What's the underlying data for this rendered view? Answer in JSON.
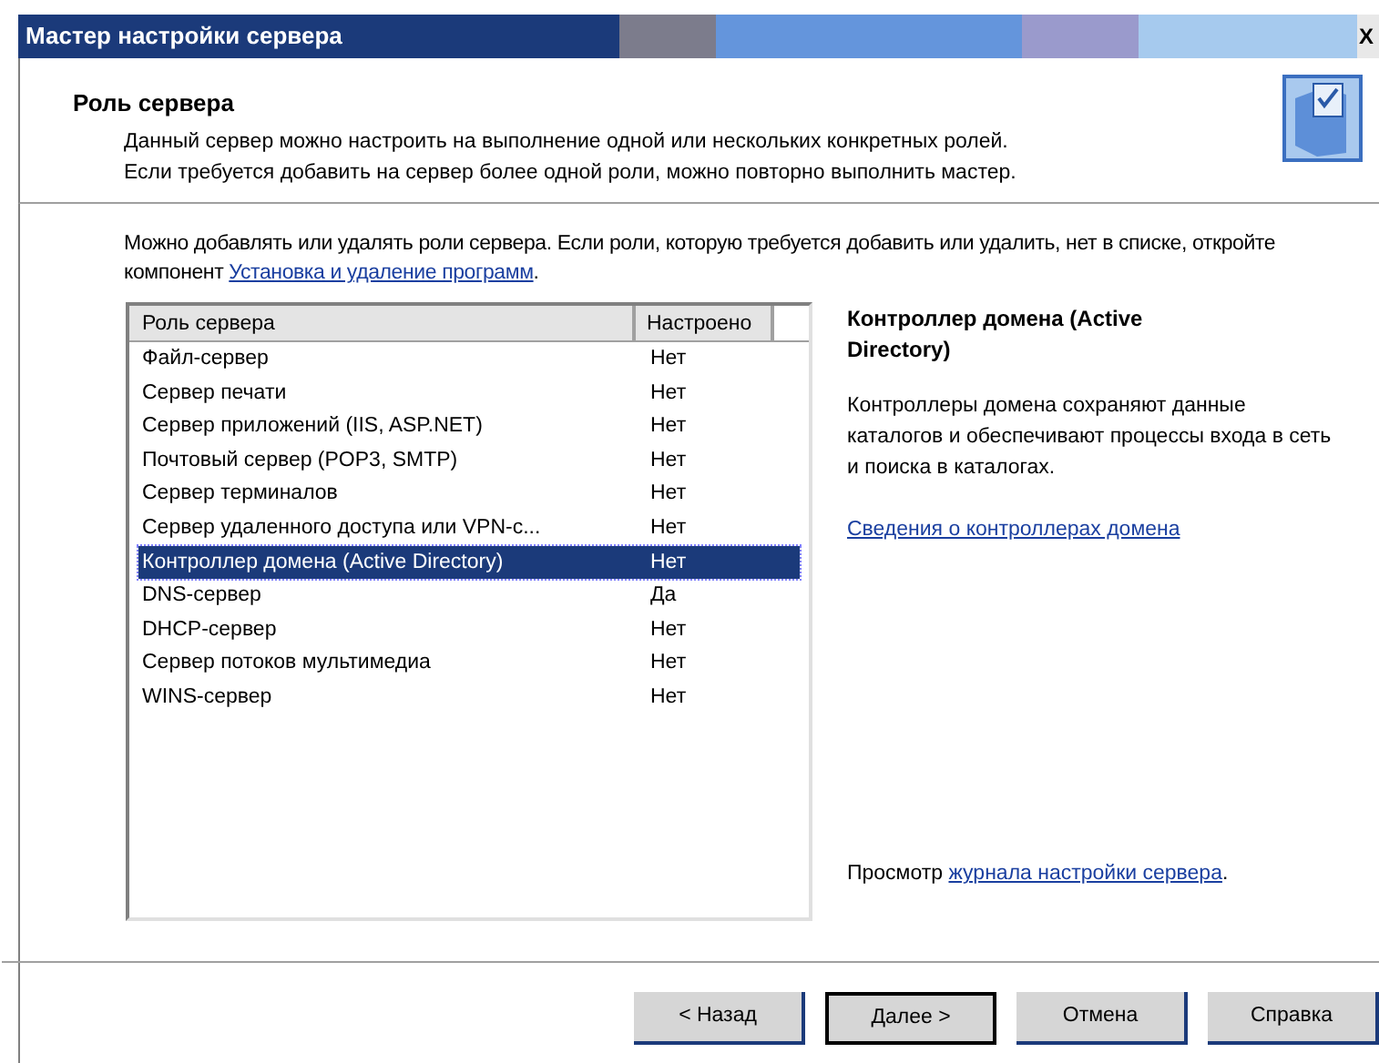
{
  "window": {
    "title": "Мастер настройки сервера",
    "close": "X"
  },
  "header": {
    "title": "Роль сервера",
    "lines": [
      "Данный сервер можно настроить на выполнение одной или нескольких конкретных ролей.",
      "Если требуется добавить на сервер более одной роли, можно повторно выполнить мастер."
    ]
  },
  "intro": {
    "text": "Можно добавлять или удалять роли сервера. Если роли, которую требуется добавить или удалить, нет в списке, откройте компонент",
    "link": "Установка и удаление программ",
    "end": "."
  },
  "table": {
    "columns": [
      "Роль сервера",
      "Настроено"
    ],
    "rows": [
      {
        "role": "Файл-сервер",
        "configured": "Нет",
        "selected": false
      },
      {
        "role": "Сервер печати",
        "configured": "Нет",
        "selected": false
      },
      {
        "role": "Сервер приложений (IIS, ASP.NET)",
        "configured": "Нет",
        "selected": false
      },
      {
        "role": "Почтовый сервер (POP3, SMTP)",
        "configured": "Нет",
        "selected": false
      },
      {
        "role": "Сервер терминалов",
        "configured": "Нет",
        "selected": false
      },
      {
        "role": "Сервер удаленного доступа или VPN-с...",
        "configured": "Нет",
        "selected": false
      },
      {
        "role": "Контроллер домена (Active Directory)",
        "configured": "Нет",
        "selected": true
      },
      {
        "role": "DNS-сервер",
        "configured": "Да",
        "selected": false
      },
      {
        "role": "DHCP-сервер",
        "configured": "Нет",
        "selected": false
      },
      {
        "role": "Сервер потоков мультимедиа",
        "configured": "Нет",
        "selected": false
      },
      {
        "role": "WINS-сервер",
        "configured": "Нет",
        "selected": false
      }
    ]
  },
  "details": {
    "title": "Контроллер домена (Active Directory)",
    "description": "Контроллеры домена сохраняют данные каталогов и обеспечивают процессы входа в сеть и поиска в каталогах.",
    "link": "Сведения о контроллерах домена",
    "log_prefix": "Просмотр",
    "log_link": "журнала настройки сервера",
    "log_end": "."
  },
  "buttons": [
    {
      "label": "< Назад",
      "default": false
    },
    {
      "label": "Далее >",
      "default": true
    },
    {
      "label": "Отмена",
      "default": false
    },
    {
      "label": "Справка",
      "default": false
    }
  ]
}
